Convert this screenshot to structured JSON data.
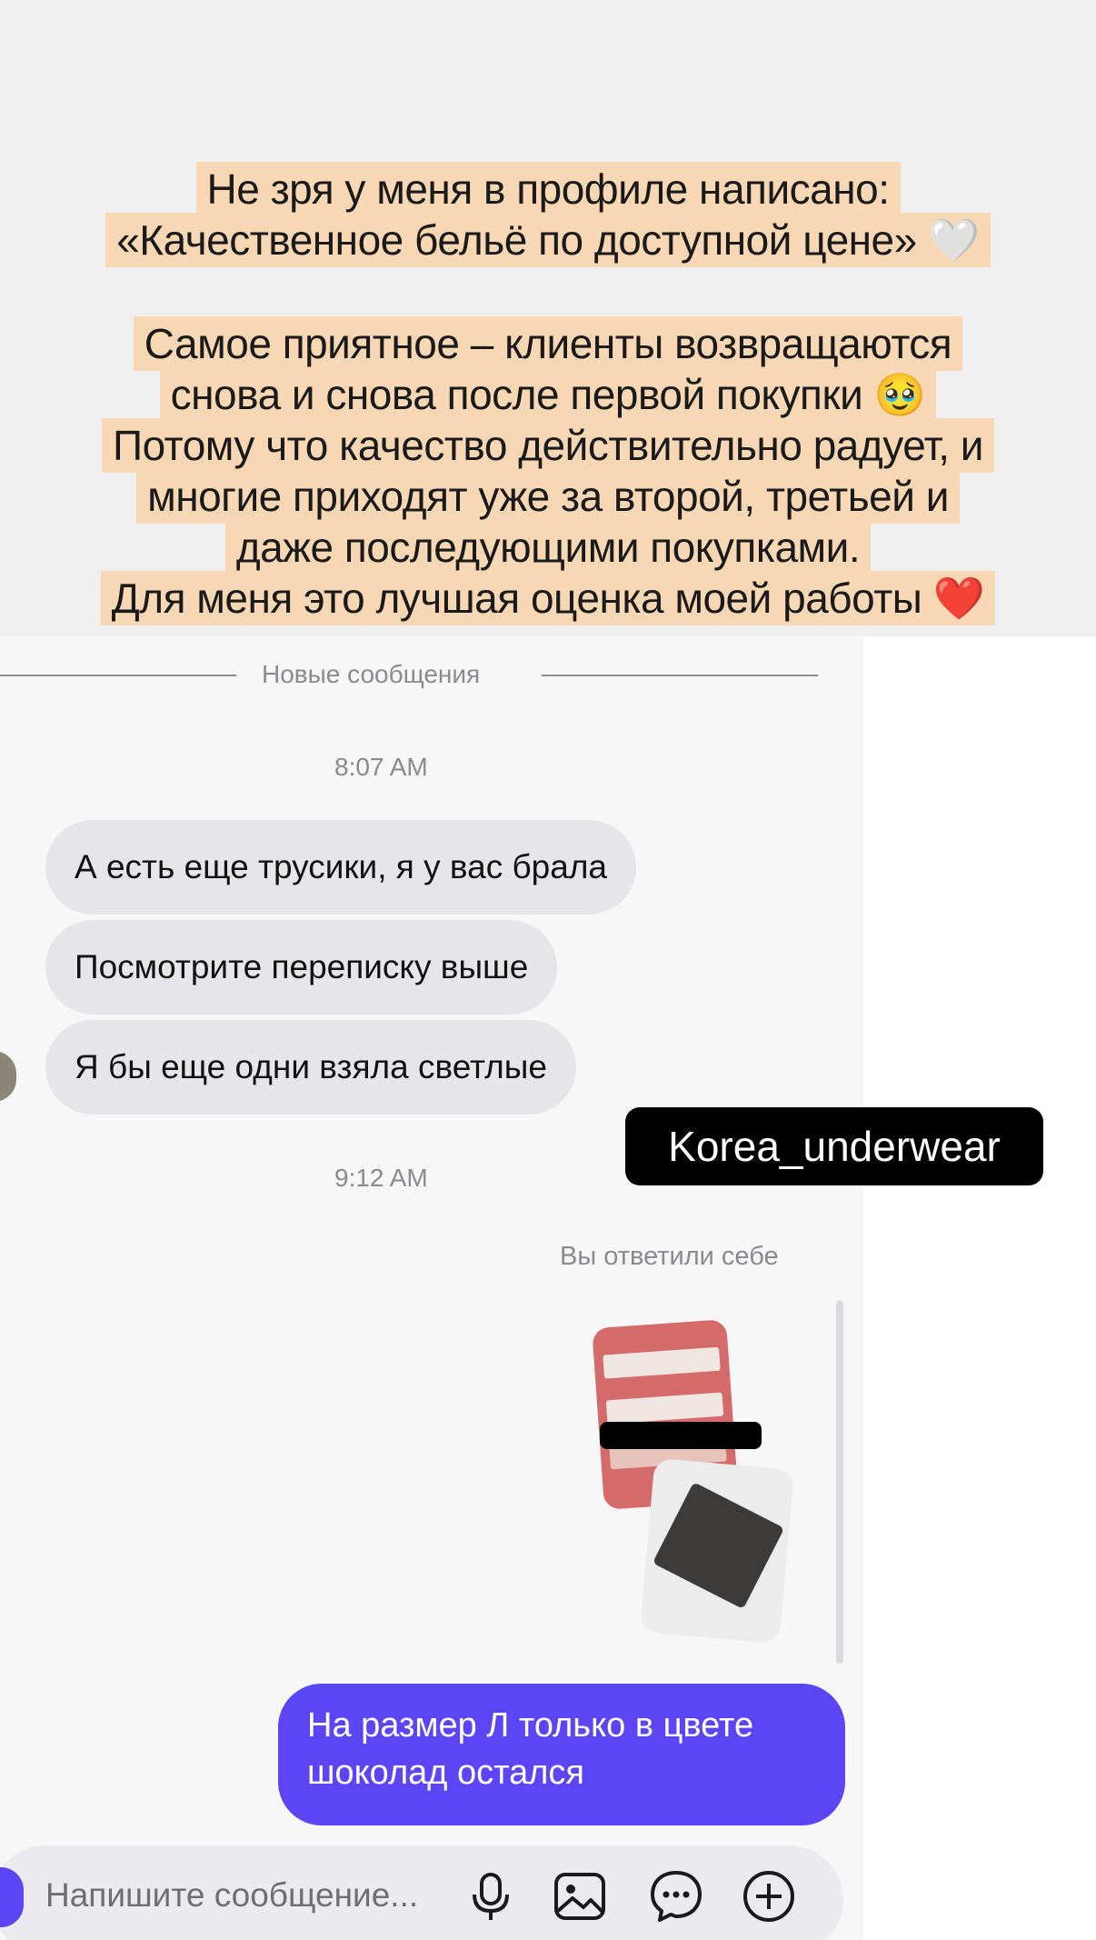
{
  "story_caption": {
    "paragraph1": [
      "Не зря у меня в профиле написано:",
      "«Качественное бельё по доступной цене» 🤍"
    ],
    "paragraph2": [
      "Самое приятное – клиенты возвращаются",
      "снова и снова после первой покупки 🥹",
      "Потому что качество действительно радует, и",
      "многие приходят уже за второй, третьей и",
      "даже последующими покупками.",
      "Для меня это лучшая оценка моей работы ❤️"
    ]
  },
  "chat": {
    "new_messages_divider": "Новые сообщения",
    "timestamp_1": "8:07 AM",
    "incoming_messages": [
      "А есть еще трусики, я у вас брала",
      "Посмотрите переписку выше",
      "Я бы еще одни взяла светлые"
    ],
    "timestamp_2": "9:12 AM",
    "reply_label": "Вы ответили себе",
    "outgoing_message": "На размер Л только в цвете шоколад остался"
  },
  "overlay_tag": "Korea_underwear",
  "composer": {
    "placeholder": "Напишите сообщение...",
    "icons": [
      "microphone-icon",
      "image-icon",
      "sticker-chat-icon",
      "plus-icon"
    ]
  },
  "colors": {
    "caption_highlight": "#f8d8b4",
    "incoming_bubble": "#e6e6ea",
    "outgoing_bubble": "#5b45f5",
    "tag_background": "#000000"
  }
}
